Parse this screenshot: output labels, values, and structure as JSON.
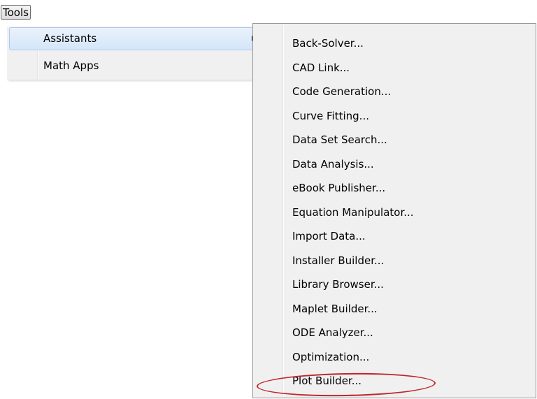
{
  "menubar": {
    "tools_label": "Tools"
  },
  "menu": {
    "items": [
      {
        "label": "Assistants",
        "has_submenu": true,
        "highlighted": true
      },
      {
        "label": "Math Apps",
        "has_submenu": false,
        "highlighted": false
      }
    ]
  },
  "submenu": {
    "items": [
      {
        "label": "Back-Solver..."
      },
      {
        "label": "CAD Link..."
      },
      {
        "label": "Code Generation..."
      },
      {
        "label": "Curve Fitting..."
      },
      {
        "label": "Data Set Search..."
      },
      {
        "label": "Data Analysis..."
      },
      {
        "label": "eBook Publisher..."
      },
      {
        "label": "Equation Manipulator..."
      },
      {
        "label": "Import Data..."
      },
      {
        "label": "Installer Builder..."
      },
      {
        "label": "Library Browser..."
      },
      {
        "label": "Maplet Builder..."
      },
      {
        "label": "ODE Analyzer..."
      },
      {
        "label": "Optimization..."
      },
      {
        "label": "Plot Builder..."
      }
    ]
  },
  "colors": {
    "menu_background": "#f0f0f0",
    "highlight_border": "#a9c9ef",
    "annotation_red": "#c0262c"
  }
}
